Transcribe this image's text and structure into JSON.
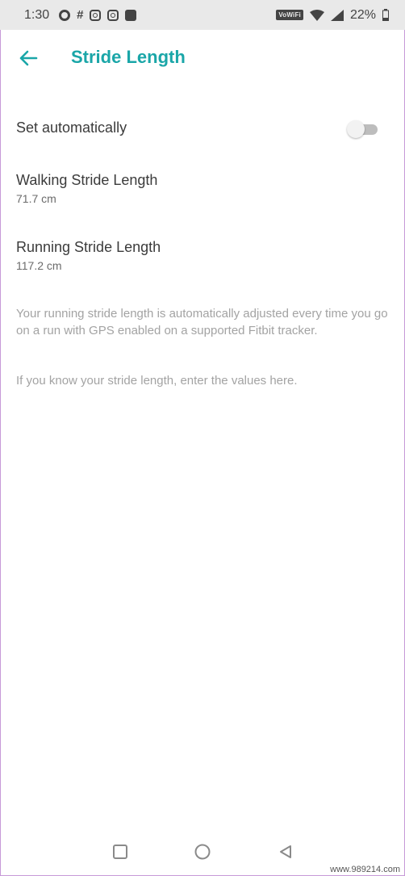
{
  "status_bar": {
    "time": "1:30",
    "network_badge": "VoWiFi",
    "battery": "22%"
  },
  "app_bar": {
    "title": "Stride Length"
  },
  "settings": {
    "auto": {
      "label": "Set automatically",
      "enabled": false
    },
    "walking": {
      "label": "Walking Stride Length",
      "value": "71.7 cm"
    },
    "running": {
      "label": "Running Stride Length",
      "value": "117.2 cm"
    }
  },
  "info": {
    "paragraph_1": "Your running stride length is automatically adjusted every time you go on a run with GPS enabled on a supported Fitbit tracker.",
    "paragraph_2": "If you know your stride length, enter the values here."
  },
  "watermark": "www.989214.com",
  "colors": {
    "accent": "#1aa6a8",
    "status_bar_bg": "#e9e9e9",
    "info_text": "#a3a3a3"
  }
}
